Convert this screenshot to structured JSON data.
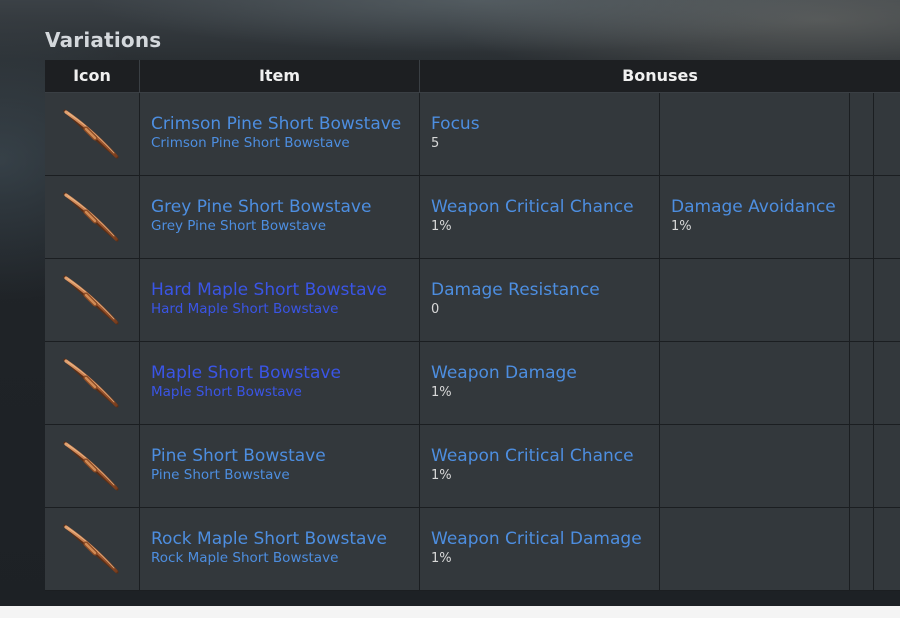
{
  "section_title": "Variations",
  "columns": {
    "icon": "Icon",
    "item": "Item",
    "bonuses": "Bonuses"
  },
  "colors": {
    "link": "#4d8ee0",
    "visited_link": "#3a55e6",
    "value": "#d8d8d8"
  },
  "rows": [
    {
      "icon": "bowstave-icon",
      "name": "Crimson Pine Short Bowstave",
      "sub": "Crimson Pine Short Bowstave",
      "visited": false,
      "bonus1": {
        "name": "Focus",
        "value": "5"
      },
      "bonus2": {
        "name": "",
        "value": ""
      }
    },
    {
      "icon": "bowstave-icon",
      "name": "Grey Pine Short Bowstave",
      "sub": "Grey Pine Short Bowstave",
      "visited": false,
      "bonus1": {
        "name": "Weapon Critical Chance",
        "value": "1%"
      },
      "bonus2": {
        "name": "Damage Avoidance",
        "value": "1%"
      }
    },
    {
      "icon": "bowstave-icon",
      "name": "Hard Maple Short Bowstave",
      "sub": "Hard Maple Short Bowstave",
      "visited": true,
      "bonus1": {
        "name": "Damage Resistance",
        "value": "0"
      },
      "bonus2": {
        "name": "",
        "value": ""
      }
    },
    {
      "icon": "bowstave-icon",
      "name": "Maple Short Bowstave",
      "sub": "Maple Short Bowstave",
      "visited": true,
      "bonus1": {
        "name": "Weapon Damage",
        "value": "1%"
      },
      "bonus2": {
        "name": "",
        "value": ""
      }
    },
    {
      "icon": "bowstave-icon",
      "name": "Pine Short Bowstave",
      "sub": "Pine Short Bowstave",
      "visited": false,
      "bonus1": {
        "name": "Weapon Critical Chance",
        "value": "1%"
      },
      "bonus2": {
        "name": "",
        "value": ""
      }
    },
    {
      "icon": "bowstave-icon",
      "name": "Rock Maple Short Bowstave",
      "sub": "Rock Maple Short Bowstave",
      "visited": false,
      "bonus1": {
        "name": "Weapon Critical Damage",
        "value": "1%"
      },
      "bonus2": {
        "name": "",
        "value": ""
      }
    }
  ]
}
